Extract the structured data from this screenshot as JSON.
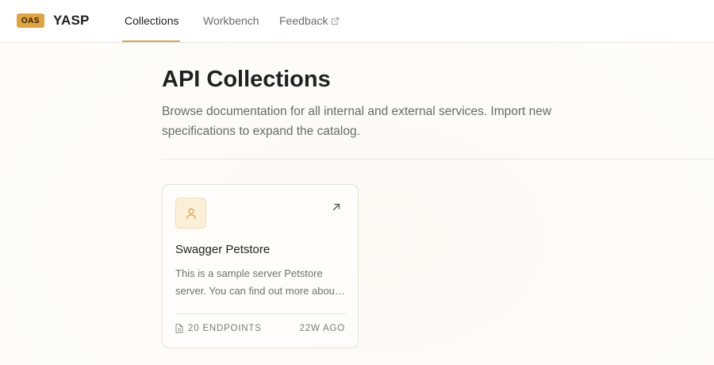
{
  "header": {
    "badge": "OAS",
    "brand": "YASP",
    "nav": [
      {
        "label": "Collections",
        "active": true
      },
      {
        "label": "Workbench",
        "active": false
      },
      {
        "label": "Feedback",
        "active": false,
        "icon": "external-link-icon"
      }
    ],
    "accent_color": "#d9a44b"
  },
  "main": {
    "title": "API Collections",
    "description": "Browse documentation for all internal and external services. Import new specifications to expand the catalog."
  },
  "collections": [
    {
      "icon": "user-icon",
      "title": "Swagger Petstore",
      "description": "This is a sample server Petstore server. You can find out more about Swagger",
      "endpoints": "20 ENDPOINTS",
      "updated": "22W AGO",
      "open_icon": "arrow-up-right-icon"
    }
  ]
}
